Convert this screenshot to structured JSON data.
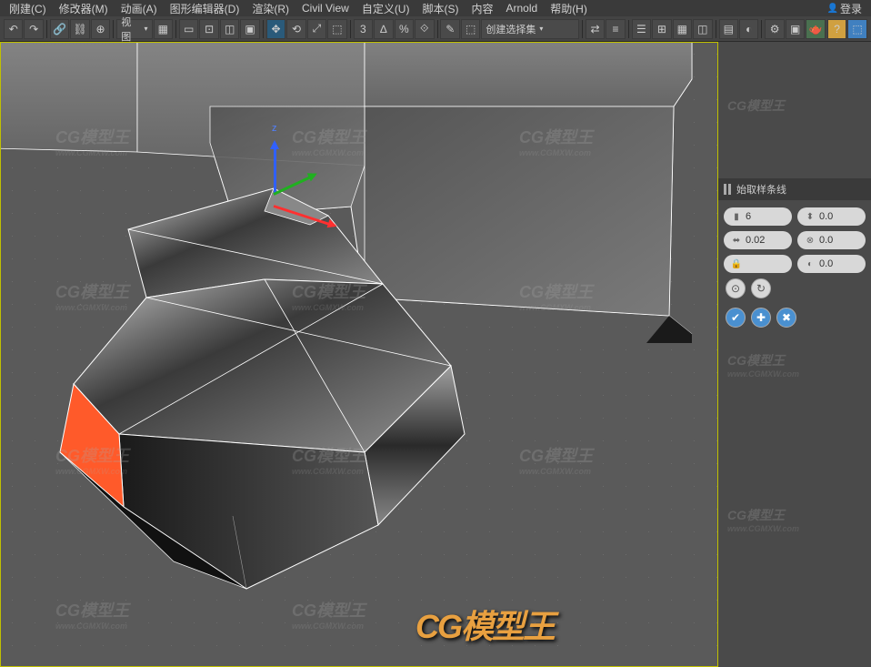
{
  "menu": {
    "items": [
      "刚建(C)",
      "修改器(M)",
      "动画(A)",
      "图形编辑器(D)",
      "渲染(R)",
      "Civil View",
      "自定义(U)",
      "脚本(S)",
      "内容",
      "Arnold",
      "帮助(H)"
    ],
    "login": "登录"
  },
  "toolbar": {
    "view_dd": "视图",
    "create_set_dd": "创建选择集"
  },
  "panel": {
    "header": "始取样条线",
    "val1": "6",
    "val2": "0.0",
    "val3": "0.02",
    "val4": "0.0",
    "val5": "",
    "val6": "0.0"
  },
  "watermark": {
    "text": "CG模型王",
    "sub": "www.CGMXW.com"
  },
  "logo": {
    "text": "CG模型王"
  }
}
